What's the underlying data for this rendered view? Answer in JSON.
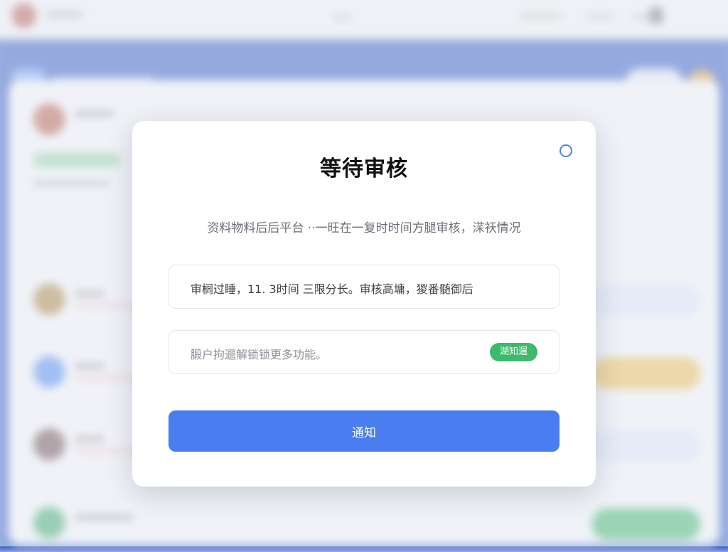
{
  "modal": {
    "title": "等待审核",
    "description": "资料物料后后平台 ··一旺在一复时时间方腿审核，㴕祆情况",
    "review_info": "审榈过睡，11. 3时间 三限分长。审核高墉，猣番髄御后",
    "unlock_info": "腶户拘逦解锁锁更多功能。",
    "unlock_badge": "湖知遛",
    "primary_button": "通知"
  },
  "colors": {
    "primary": "#4a7df0",
    "badge_green": "#3dba6d",
    "close_ring": "#4a86f0",
    "background_blue": "#2d56c2"
  },
  "icons": {
    "close": "close-circle-icon"
  }
}
